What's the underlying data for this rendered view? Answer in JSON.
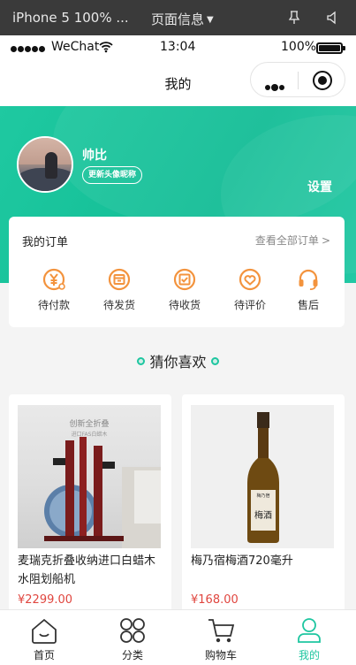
{
  "devtools": {
    "device": "iPhone 5 100% ...",
    "page_info": "页面信息",
    "caret": "▼"
  },
  "status_bar": {
    "carrier": "WeChat",
    "time": "13:04",
    "battery": "100%"
  },
  "nav": {
    "title": "我的"
  },
  "profile": {
    "username": "帅比",
    "edit_label": "更新头像昵称",
    "settings_label": "设置"
  },
  "orders": {
    "title": "我的订单",
    "view_all": "查看全部订单",
    "view_all_chevron": ">",
    "items": [
      {
        "label": "待付款",
        "icon": "yen-payment-icon"
      },
      {
        "label": "待发货",
        "icon": "package-icon"
      },
      {
        "label": "待收货",
        "icon": "receive-check-icon"
      },
      {
        "label": "待评价",
        "icon": "heart-review-icon"
      },
      {
        "label": "售后",
        "icon": "headset-service-icon"
      }
    ]
  },
  "guess": {
    "title": "猜你喜欢"
  },
  "products": [
    {
      "name": "麦瑞克折叠收纳进口白蜡木水阻划船机",
      "price": "¥2299.00",
      "image_text": [
        "创新全折叠",
        "进口FAS白蜡木"
      ]
    },
    {
      "name": "梅乃宿梅酒720毫升",
      "price": "¥168.00",
      "image_text": [
        "梅乃宿",
        "梅酒"
      ]
    }
  ],
  "tabs": [
    {
      "label": "首页",
      "icon": "home-icon",
      "active": false
    },
    {
      "label": "分类",
      "icon": "category-icon",
      "active": false
    },
    {
      "label": "购物车",
      "icon": "cart-icon",
      "active": false
    },
    {
      "label": "我的",
      "icon": "user-icon",
      "active": true
    }
  ],
  "colors": {
    "brand_green": "#1ec6a0",
    "order_icon_orange": "#f3933d",
    "price_red": "#e0463f"
  }
}
